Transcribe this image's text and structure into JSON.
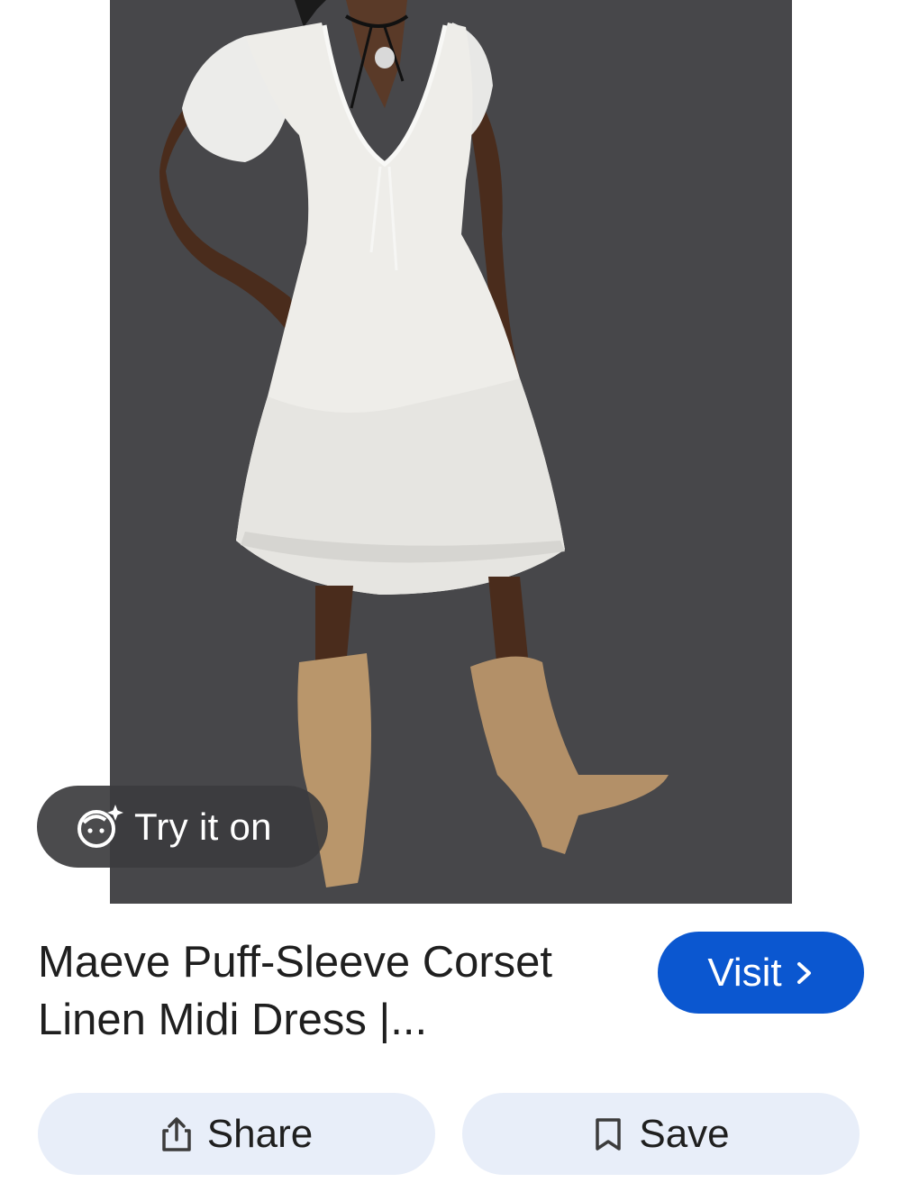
{
  "result": {
    "image_alt": "Model wearing a white puff-sleeve corset linen midi dress with tan suede western boots",
    "try_on_label": "Try it on",
    "title": "Maeve Puff-Sleeve Corset Linen Midi Dress |...",
    "visit_label": "Visit"
  },
  "actions": {
    "share_label": "Share",
    "save_label": "Save"
  },
  "icons": {
    "try_on": "face-sparkle-icon",
    "visit": "chevron-right-icon",
    "share": "share-icon",
    "save": "bookmark-icon"
  },
  "colors": {
    "visit_bg": "#0b57d0",
    "action_bg": "#e8eef9",
    "chip_bg": "#3c3c3e",
    "photo_bg": "#48484a"
  }
}
